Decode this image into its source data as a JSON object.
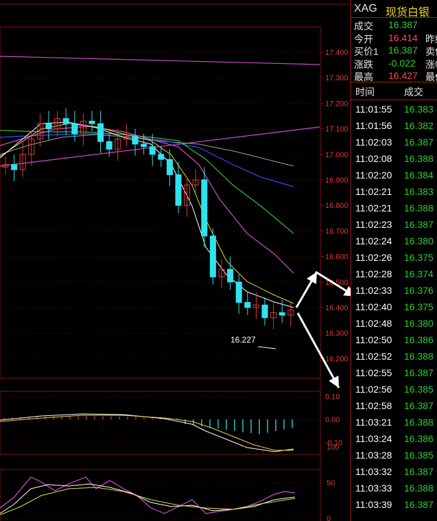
{
  "colors": {
    "up": "#ff4a4a",
    "down": "#2ed02e",
    "grid": "#8a1010",
    "axis_text": "#e23a3a",
    "neutral": "#e6e6e6",
    "accent_name": "#f2d21a"
  },
  "main_chart": {
    "price_axis_labels": [
      "17.400",
      "17.300",
      "17.200",
      "17.100",
      "17.000",
      "16.900",
      "16.800",
      "16.700",
      "16.600",
      "16.500",
      "16.400",
      "16.300",
      "16.200"
    ],
    "low_label": "16.227",
    "candles_close_approx": [
      16.96,
      16.94,
      17.0,
      17.06,
      17.12,
      17.1,
      17.14,
      17.12,
      17.08,
      17.13,
      17.12,
      17.05,
      17.02,
      17.06,
      17.07,
      17.04,
      17.03,
      17.0,
      16.98,
      16.92,
      16.8,
      16.88,
      16.9,
      16.68,
      16.52,
      16.55,
      16.5,
      16.42,
      16.4,
      16.41,
      16.36,
      16.38,
      16.37,
      16.39
    ]
  },
  "macd": {
    "axis_labels": [
      "0.10",
      "0.00",
      "-0.10"
    ]
  },
  "kdj": {
    "axis_labels": [
      "100",
      "50",
      "0"
    ]
  },
  "right_panel": {
    "code": "XAG",
    "name": "现货白银",
    "quotes": [
      {
        "label": "成交",
        "value": "16.387",
        "ext": "",
        "cls": "dn"
      },
      {
        "label": "今开",
        "value": "16.414",
        "ext": "昨结",
        "cls": "up"
      },
      {
        "label": "买价1",
        "value": "16.387",
        "ext": "卖价",
        "cls": "dn"
      },
      {
        "label": "涨跌",
        "value": "-0.022",
        "ext": "涨幅",
        "cls": "dn"
      },
      {
        "label": "最高",
        "value": "16.427",
        "ext": "最低",
        "cls": "up"
      }
    ],
    "ticks_header": {
      "time": "时间",
      "price": "成交"
    },
    "ticks": [
      {
        "time": "11:01:55",
        "price": "16.383",
        "cls": "dn"
      },
      {
        "time": "11:01:56",
        "price": "16.382",
        "cls": "dn"
      },
      {
        "time": "11:02:03",
        "price": "16.387",
        "cls": "dn"
      },
      {
        "time": "11:02:08",
        "price": "16.388",
        "cls": "dn"
      },
      {
        "time": "11:02:20",
        "price": "16.384",
        "cls": "dn"
      },
      {
        "time": "11:02:21",
        "price": "16.383",
        "cls": "dn"
      },
      {
        "time": "11:02:21",
        "price": "16.388",
        "cls": "dn"
      },
      {
        "time": "11:02:23",
        "price": "16.387",
        "cls": "dn"
      },
      {
        "time": "11:02:24",
        "price": "16.380",
        "cls": "dn"
      },
      {
        "time": "11:02:26",
        "price": "16.375",
        "cls": "dn"
      },
      {
        "time": "11:02:28",
        "price": "16.374",
        "cls": "dn"
      },
      {
        "time": "11:02:33",
        "price": "16.376",
        "cls": "dn"
      },
      {
        "time": "11:02:40",
        "price": "16.375",
        "cls": "dn"
      },
      {
        "time": "11:02:48",
        "price": "16.380",
        "cls": "dn"
      },
      {
        "time": "11:02:50",
        "price": "16.386",
        "cls": "dn"
      },
      {
        "time": "11:02:52",
        "price": "16.388",
        "cls": "dn"
      },
      {
        "time": "11:02:55",
        "price": "16.387",
        "cls": "dn"
      },
      {
        "time": "11:02:56",
        "price": "16.385",
        "cls": "dn"
      },
      {
        "time": "11:02:58",
        "price": "16.387",
        "cls": "dn"
      },
      {
        "time": "11:03:21",
        "price": "16.388",
        "cls": "dn"
      },
      {
        "time": "11:03:24",
        "price": "16.386",
        "cls": "dn"
      },
      {
        "time": "11:03:28",
        "price": "16.385",
        "cls": "dn"
      },
      {
        "time": "11:03:32",
        "price": "16.387",
        "cls": "dn"
      },
      {
        "time": "11:03:33",
        "price": "16.388",
        "cls": "dn"
      },
      {
        "time": "11:03:39",
        "price": "16.387",
        "cls": "dn"
      }
    ]
  }
}
